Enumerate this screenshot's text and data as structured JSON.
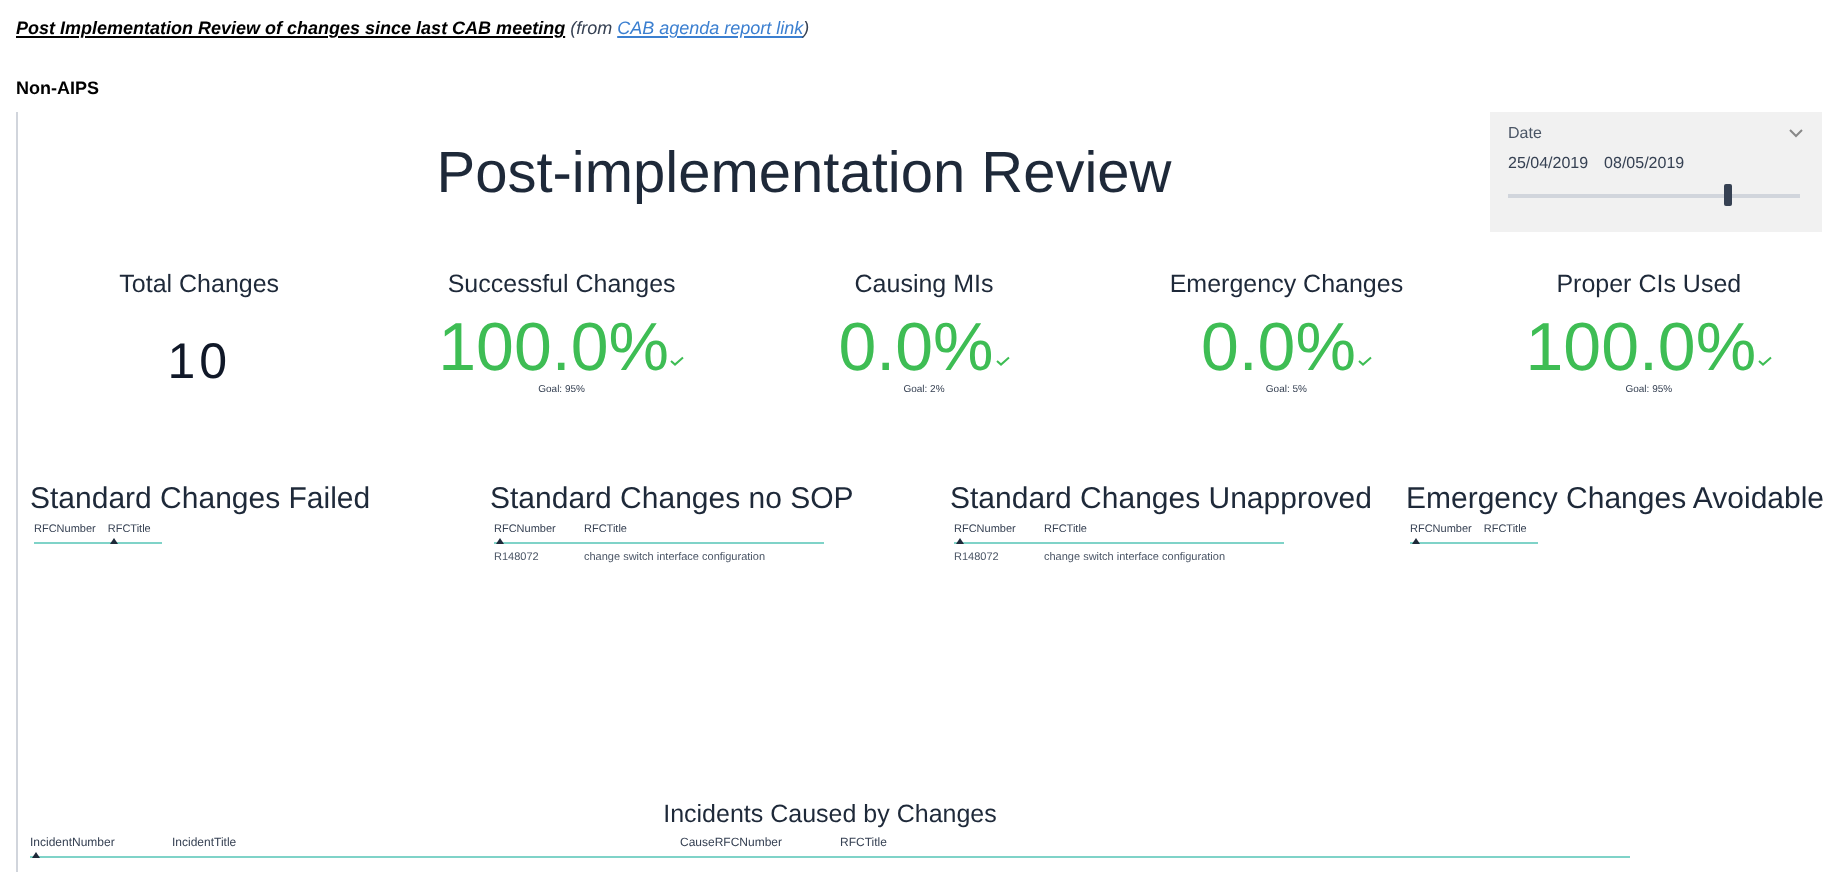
{
  "heading": {
    "title": "Post Implementation Review of changes since last CAB meeting",
    "note_prefix": "(from ",
    "link": "CAB agenda report link",
    "note_suffix": ")"
  },
  "section_label": "Non-AIPS",
  "report": {
    "title": "Post-implementation Review",
    "date_slicer": {
      "label": "Date",
      "start": "25/04/2019",
      "end": "08/05/2019",
      "level": 0.75
    },
    "kpis": [
      {
        "kind": "count",
        "label": "Total Changes",
        "value": "10"
      },
      {
        "kind": "percent",
        "label": "Successful Changes",
        "value": "100.0%",
        "goal": "Goal: 95%"
      },
      {
        "kind": "percent",
        "label": "Causing MIs",
        "value": "0.0%",
        "goal": "Goal: 2%"
      },
      {
        "kind": "percent",
        "label": "Emergency Changes",
        "value": "0.0%",
        "goal": "Goal: 5%"
      },
      {
        "kind": "percent",
        "label": "Proper CIs Used",
        "value": "100.0%",
        "goal": "Goal: 95%"
      }
    ],
    "tables": [
      {
        "title": "Standard Changes Failed",
        "columns": [
          {
            "label": "RFCNumber",
            "sorted": false
          },
          {
            "label": "RFCTitle",
            "sorted": true
          }
        ]
      },
      {
        "title": "Standard Changes no SOP",
        "columns": [
          {
            "label": "RFCNumber",
            "sorted": true
          },
          {
            "label": "RFCTitle",
            "sorted": false
          }
        ],
        "rows": [
          [
            "R148072",
            "change switch interface configuration"
          ]
        ]
      },
      {
        "title": "Standard Changes Unapproved",
        "columns": [
          {
            "label": "RFCNumber",
            "sorted": true
          },
          {
            "label": "RFCTitle",
            "sorted": false
          }
        ],
        "rows": [
          [
            "R148072",
            "change switch interface configuration"
          ]
        ]
      },
      {
        "title": "Emergency Changes Avoidable",
        "columns": [
          {
            "label": "RFCNumber",
            "sorted": true
          },
          {
            "label": "RFCTitle",
            "sorted": false
          }
        ]
      }
    ],
    "incidents": {
      "title": "Incidents Caused by Changes",
      "columns": [
        {
          "label": "IncidentNumber",
          "sorted": true
        },
        {
          "label": "IncidentTitle",
          "sorted": false
        },
        {
          "label": "CauseRFCNumber",
          "sorted": false
        },
        {
          "label": "RFCTitle",
          "sorted": false
        }
      ]
    }
  }
}
